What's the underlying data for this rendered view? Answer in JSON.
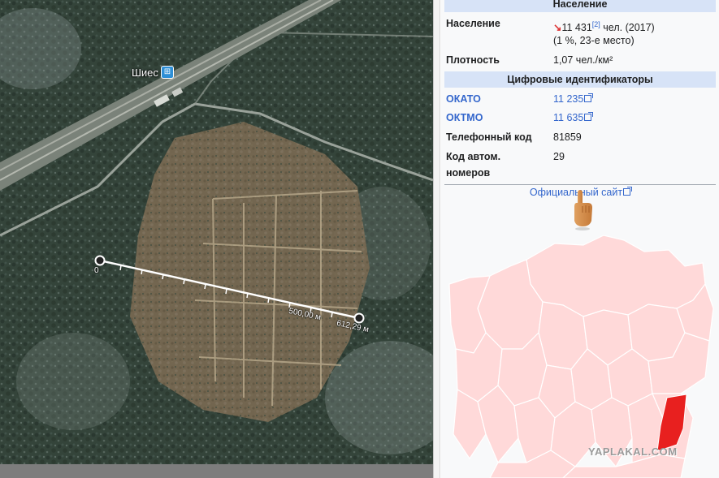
{
  "map": {
    "station_name": "Шиес",
    "station_icon": "train-icon",
    "ruler_start_label": "0",
    "ruler_mid_label": "500,00 м",
    "ruler_end_label": "612,29 м"
  },
  "infobox": {
    "population_header": "Население",
    "population_label": "Население",
    "population_value": "11 431",
    "population_ref": "[2]",
    "population_unit": " чел. (2017)",
    "population_rank": "(1 %, 23-е место)",
    "density_label": "Плотность",
    "density_value": "1,07 чел./км²",
    "ids_header": "Цифровые идентификаторы",
    "okato_label": "ОКАТО",
    "okato_value": "11 235",
    "oktmo_label": "ОКТМО",
    "oktmo_value": "11 635",
    "phone_label": "Телефонный код",
    "phone_value": "81859",
    "plates_label_1": "Код автом.",
    "plates_label_2": "номеров",
    "plates_value": "29",
    "official_site": "Официальный сайт"
  },
  "colors": {
    "header_bg": "#d7e3f7",
    "link": "#3366cc",
    "region_fill": "#ffd9d9",
    "region_highlight": "#e8201f",
    "trend_down": "#dd3333"
  },
  "watermark": "YAPLAKAL.COM"
}
